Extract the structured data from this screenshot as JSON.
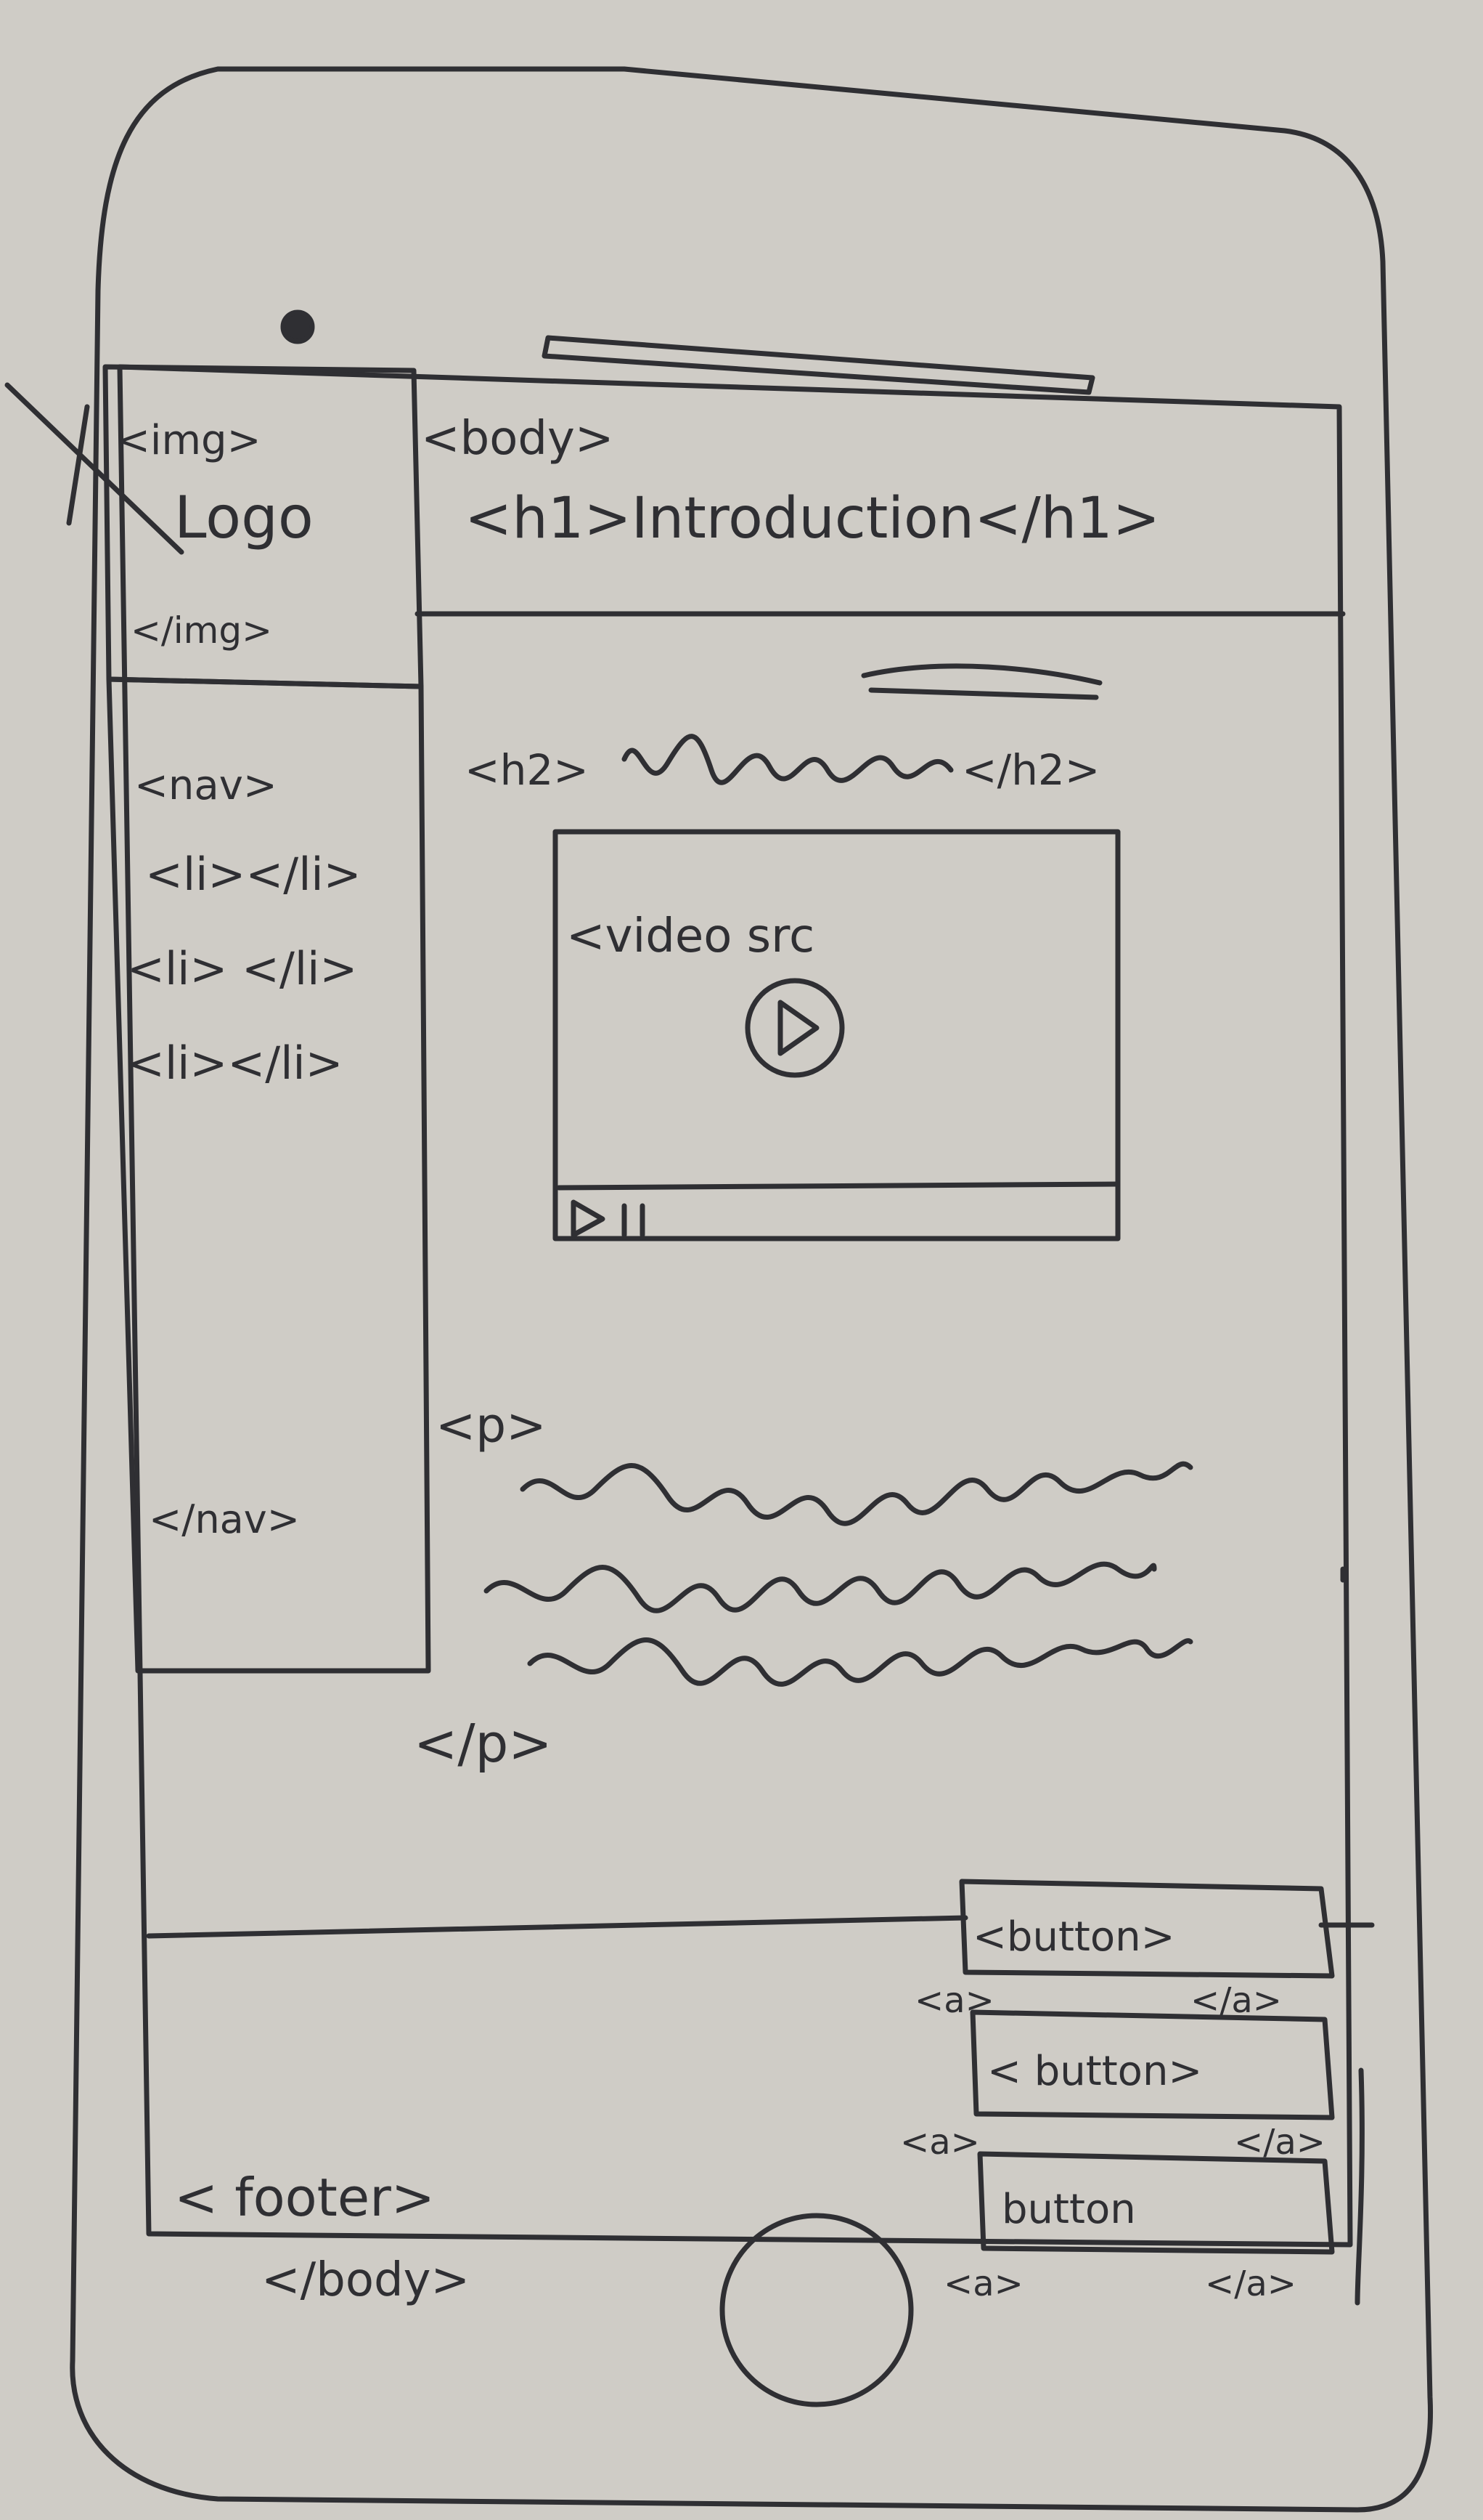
{
  "paper_color": "#cfccc6",
  "ink_color": "#2f2f33",
  "sidebar": {
    "img_open": "<img>",
    "logo": "Logo",
    "img_close": "</img>",
    "nav_open": "<nav>",
    "list_items": [
      "<li></li>",
      "<li> </li>",
      "<li></li>"
    ],
    "nav_close": "</nav>"
  },
  "header": {
    "body_open": "<body>",
    "h1": "<h1>Introduction</h1>"
  },
  "main": {
    "h2_open": "<h2>",
    "h2_close": "</h2>",
    "video_label": "<video src",
    "play_icon": "play-icon",
    "controls_icon": "play-pause-icon",
    "p_open": "<p>",
    "p_close": "</p>"
  },
  "buttons": [
    {
      "label": "<button>",
      "a_open": "<a>",
      "a_close": "</a>"
    },
    {
      "label": "< button>",
      "a_open": "<a>",
      "a_close": "</a>"
    },
    {
      "label": "button",
      "a_open": "<a>",
      "a_close": "</a>"
    }
  ],
  "footer": {
    "footer_open": "< footer>",
    "body_close": "</body>"
  }
}
